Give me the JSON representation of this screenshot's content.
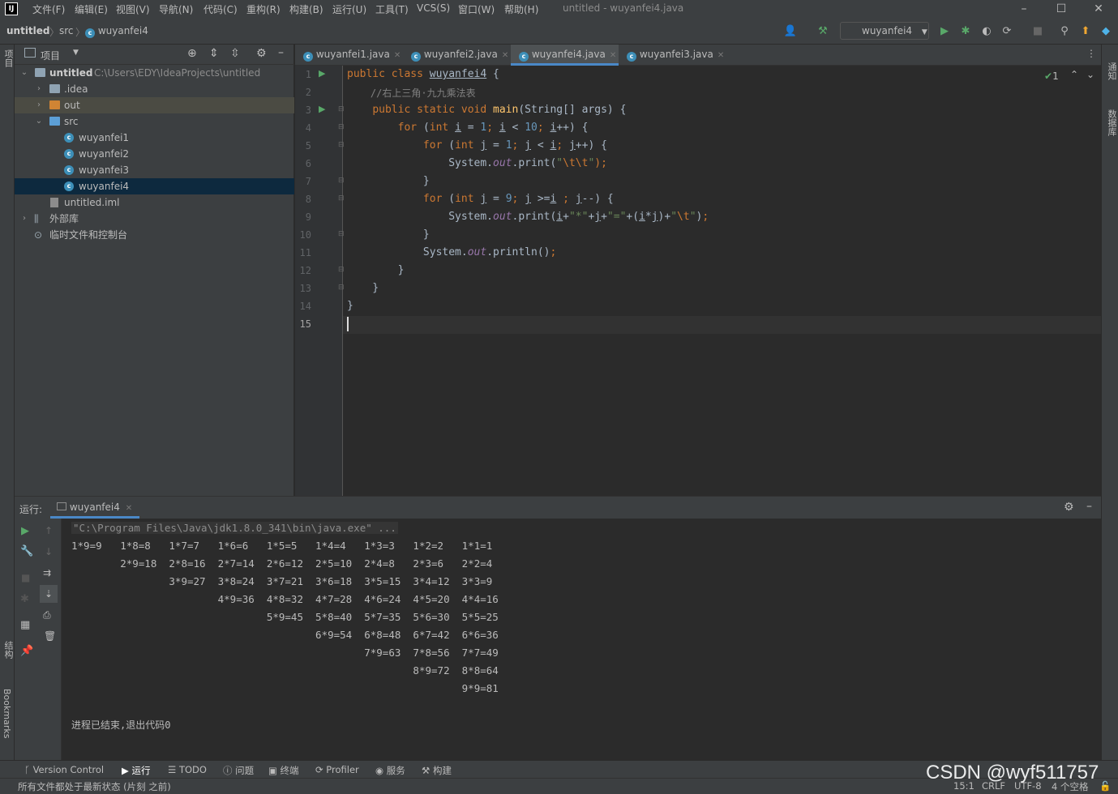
{
  "app": {
    "logo_text": "IJ",
    "window_title": "untitled - wuyanfei4.java",
    "menu": [
      "文件(F)",
      "编辑(E)",
      "视图(V)",
      "导航(N)",
      "代码(C)",
      "重构(R)",
      "构建(B)",
      "运行(U)",
      "工具(T)",
      "VCS(S)",
      "窗口(W)",
      "帮助(H)"
    ]
  },
  "breadcrumb": {
    "project": "untitled",
    "folder": "src",
    "file": "wuyanfei4"
  },
  "toolbar": {
    "run_config": "wuyanfei4"
  },
  "side_labels": {
    "project": "项目",
    "structure": "结构",
    "bookmarks": "Bookmarks",
    "notifications": "通知",
    "database": "数据库"
  },
  "project_panel": {
    "title": "项目",
    "tree": {
      "root": "untitled",
      "root_path": "C:\\Users\\EDY\\IdeaProjects\\untitled",
      "idea": ".idea",
      "out": "out",
      "src": "src",
      "files": [
        "wuyanfei1",
        "wuyanfei2",
        "wuyanfei3",
        "wuyanfei4"
      ],
      "iml": "untitled.iml",
      "external_libs": "外部库",
      "scratches": "临时文件和控制台"
    }
  },
  "editor": {
    "tabs": [
      "wuyanfei1.java",
      "wuyanfei2.java",
      "wuyanfei4.java",
      "wuyanfei3.java"
    ],
    "active_tab": "wuyanfei4.java",
    "inspection_count": "1",
    "line_numbers": [
      "1",
      "2",
      "3",
      "4",
      "5",
      "6",
      "7",
      "8",
      "9",
      "10",
      "11",
      "12",
      "13",
      "14",
      "15"
    ],
    "code": {
      "class_name": "wuyanfei4",
      "comment": "//右上三角·九九乘法表"
    }
  },
  "run_panel": {
    "label": "运行:",
    "tab": "wuyanfei4",
    "command": "\"C:\\Program Files\\Java\\jdk1.8.0_341\\bin\\java.exe\" ...",
    "output": [
      "1*9=9   1*8=8   1*7=7   1*6=6   1*5=5   1*4=4   1*3=3   1*2=2   1*1=1",
      "        2*9=18  2*8=16  2*7=14  2*6=12  2*5=10  2*4=8   2*3=6   2*2=4",
      "                3*9=27  3*8=24  3*7=21  3*6=18  3*5=15  3*4=12  3*3=9",
      "                        4*9=36  4*8=32  4*7=28  4*6=24  4*5=20  4*4=16",
      "                                5*9=45  5*8=40  5*7=35  5*6=30  5*5=25",
      "                                        6*9=54  6*8=48  6*7=42  6*6=36",
      "                                                7*9=63  7*8=56  7*7=49",
      "                                                        8*9=72  8*8=64",
      "                                                                9*9=81"
    ],
    "exit_message": "进程已结束,退出代码0"
  },
  "bottom_tools": [
    "Version Control",
    "运行",
    "TODO",
    "问题",
    "终端",
    "Profiler",
    "服务",
    "构建"
  ],
  "status": {
    "message": "所有文件都处于最新状态 (片刻 之前)",
    "position": "15:1",
    "line_sep": "CRLF",
    "encoding": "UTF-8",
    "indent": "4 个空格"
  },
  "watermark": "CSDN @wyf511757"
}
